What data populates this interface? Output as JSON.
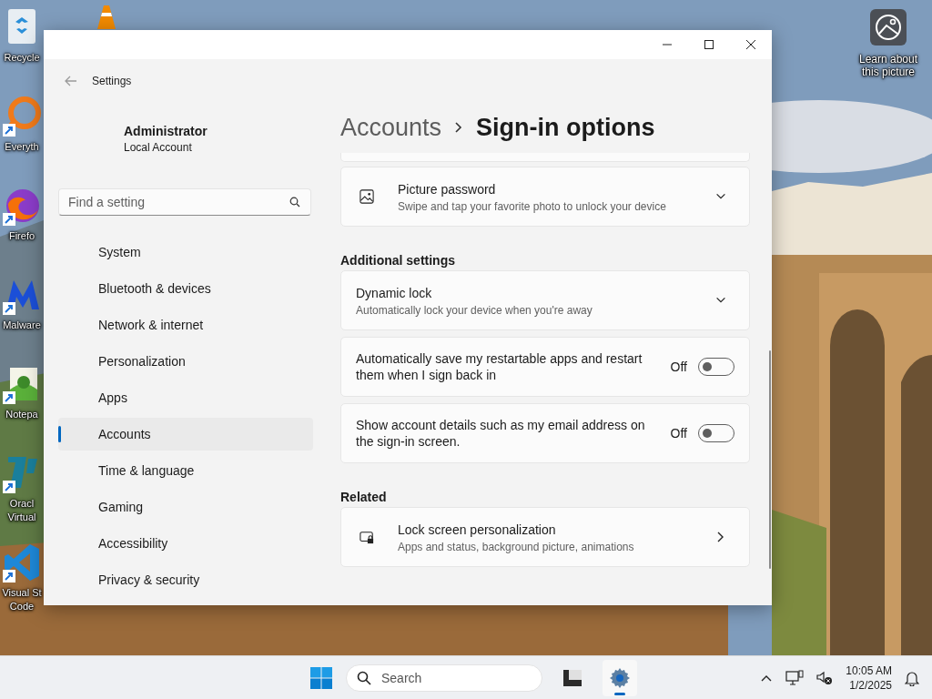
{
  "desktop": {
    "icons": [
      {
        "lines": [
          "Recycle"
        ],
        "shortcut": false
      },
      {
        "lines": [
          "Everyth"
        ],
        "shortcut": true
      },
      {
        "lines": [
          "Firefo"
        ],
        "shortcut": true
      },
      {
        "lines": [
          "Malware"
        ],
        "shortcut": true
      },
      {
        "lines": [
          "Notepa"
        ],
        "shortcut": true
      },
      {
        "lines": [
          "Oracl",
          "Virtual"
        ],
        "shortcut": true
      },
      {
        "lines": [
          "Visual St",
          "Code"
        ],
        "shortcut": true
      }
    ],
    "spotlight": {
      "lines": [
        "Learn about",
        "this picture"
      ]
    }
  },
  "window": {
    "app_title": "Settings"
  },
  "sidebar": {
    "user": {
      "name": "Administrator",
      "account": "Local Account"
    },
    "search": {
      "placeholder": "Find a setting"
    },
    "nav": [
      {
        "label": "System",
        "selected": false
      },
      {
        "label": "Bluetooth & devices",
        "selected": false
      },
      {
        "label": "Network & internet",
        "selected": false
      },
      {
        "label": "Personalization",
        "selected": false
      },
      {
        "label": "Apps",
        "selected": false
      },
      {
        "label": "Accounts",
        "selected": true
      },
      {
        "label": "Time & language",
        "selected": false
      },
      {
        "label": "Gaming",
        "selected": false
      },
      {
        "label": "Accessibility",
        "selected": false
      },
      {
        "label": "Privacy & security",
        "selected": false
      }
    ]
  },
  "content": {
    "breadcrumb": {
      "parent": "Accounts",
      "current": "Sign-in options"
    },
    "sections": [
      {
        "cards": [
          {
            "kind": "stub"
          },
          {
            "kind": "expander",
            "icon": true,
            "title": "Picture password",
            "description": "Swipe and tap your favorite photo to unlock your device",
            "expanded": false
          }
        ]
      },
      {
        "heading": "Additional settings",
        "cards": [
          {
            "kind": "expander",
            "icon": false,
            "title": "Dynamic lock",
            "description": "Automatically lock your device when you're away",
            "expanded": false
          },
          {
            "kind": "toggle",
            "title": "Automatically save my restartable apps and restart them when I sign back in",
            "state_label": "Off",
            "on": false
          },
          {
            "kind": "toggle",
            "title": "Show account details such as my email address on the sign-in screen.",
            "state_label": "Off",
            "on": false
          }
        ]
      },
      {
        "heading": "Related",
        "cards": [
          {
            "kind": "link",
            "icon": true,
            "title": "Lock screen personalization",
            "description": "Apps and status, background picture, animations"
          }
        ]
      }
    ]
  },
  "taskbar": {
    "search": {
      "placeholder": "Search"
    },
    "apps": [
      {
        "active": false
      },
      {
        "active": true
      }
    ],
    "clock": {
      "time": "10:05 AM",
      "date": "1/2/2025"
    }
  }
}
